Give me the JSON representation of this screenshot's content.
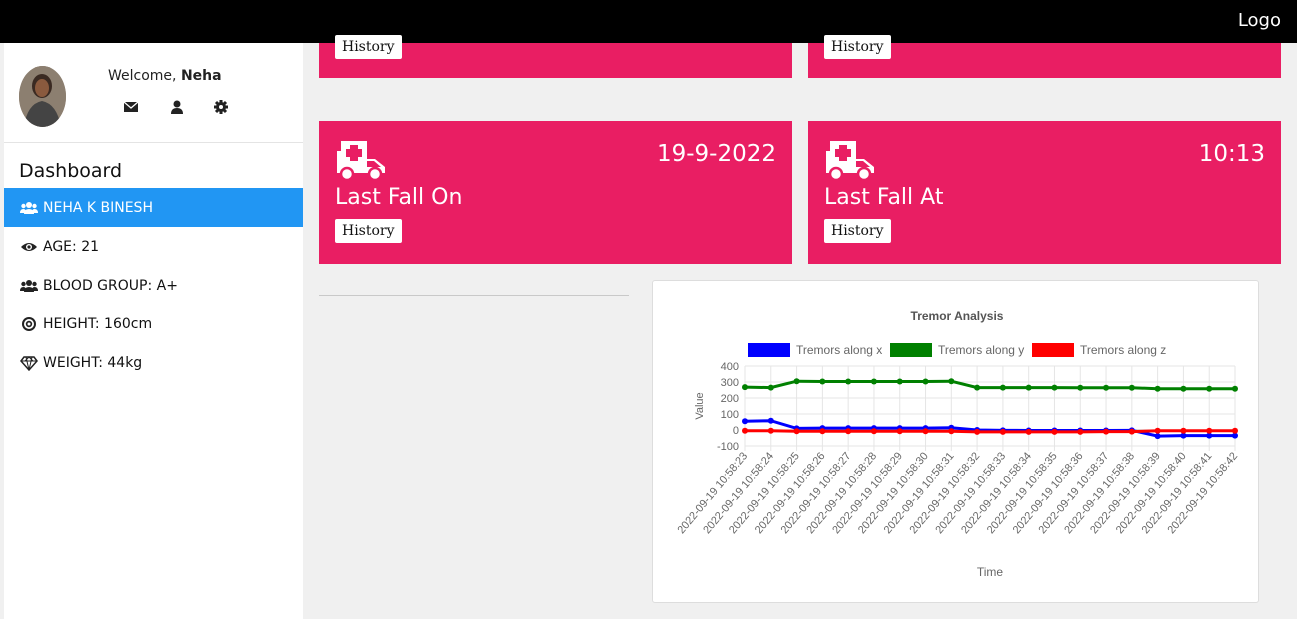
{
  "topbar": {
    "logo": "Logo"
  },
  "profile": {
    "welcome_prefix": "Welcome, ",
    "name": "Neha"
  },
  "sidebar": {
    "heading": "Dashboard",
    "items": [
      {
        "label": "NEHA K BINESH",
        "icon": "users-icon"
      },
      {
        "label": "AGE: 21",
        "icon": "eye-icon"
      },
      {
        "label": "BLOOD GROUP: A+",
        "icon": "users-icon"
      },
      {
        "label": "HEIGHT: 160cm",
        "icon": "target-icon"
      },
      {
        "label": "WEIGHT: 44kg",
        "icon": "diamond-icon"
      }
    ]
  },
  "cards": {
    "top_left": {
      "button": "History"
    },
    "top_right": {
      "button": "History"
    },
    "fall_date": {
      "value": "19-9-2022",
      "title": "Last Fall On",
      "button": "History",
      "icon": "ambulance-icon"
    },
    "fall_time": {
      "value": "10:13",
      "title": "Last Fall At",
      "button": "History",
      "icon": "ambulance-icon"
    }
  },
  "colors": {
    "card": "#e91e63",
    "active": "#2196F3"
  },
  "chart_data": {
    "type": "line",
    "title": "Tremor Analysis",
    "xlabel": "Time",
    "ylabel": "Value",
    "ylim": [
      -100,
      400
    ],
    "yticks": [
      -100,
      0,
      100,
      200,
      300,
      400
    ],
    "legend": "top",
    "grid": true,
    "x": [
      "2022-09-19 10:58:23",
      "2022-09-19 10:58:24",
      "2022-09-19 10:58:25",
      "2022-09-19 10:58:26",
      "2022-09-19 10:58:27",
      "2022-09-19 10:58:28",
      "2022-09-19 10:58:29",
      "2022-09-19 10:58:30",
      "2022-09-19 10:58:31",
      "2022-09-19 10:58:32",
      "2022-09-19 10:58:33",
      "2022-09-19 10:58:34",
      "2022-09-19 10:58:35",
      "2022-09-19 10:58:36",
      "2022-09-19 10:58:37",
      "2022-09-19 10:58:38",
      "2022-09-19 10:58:39",
      "2022-09-19 10:58:40",
      "2022-09-19 10:58:41",
      "2022-09-19 10:58:42"
    ],
    "series": [
      {
        "name": "Tremors along x",
        "color": "#0000ff",
        "values": [
          55,
          58,
          10,
          12,
          12,
          12,
          12,
          12,
          14,
          0,
          -2,
          -3,
          -3,
          -3,
          -3,
          -2,
          -38,
          -35,
          -35,
          -35
        ]
      },
      {
        "name": "Tremors along y",
        "color": "#008000",
        "values": [
          268,
          265,
          305,
          303,
          303,
          303,
          303,
          303,
          305,
          265,
          265,
          265,
          265,
          264,
          264,
          264,
          258,
          258,
          258,
          258
        ]
      },
      {
        "name": "Tremors along z",
        "color": "#ff0000",
        "values": [
          -5,
          -5,
          -8,
          -8,
          -8,
          -8,
          -8,
          -8,
          -8,
          -12,
          -12,
          -12,
          -12,
          -12,
          -10,
          -10,
          -5,
          -5,
          -5,
          -5
        ]
      }
    ]
  }
}
